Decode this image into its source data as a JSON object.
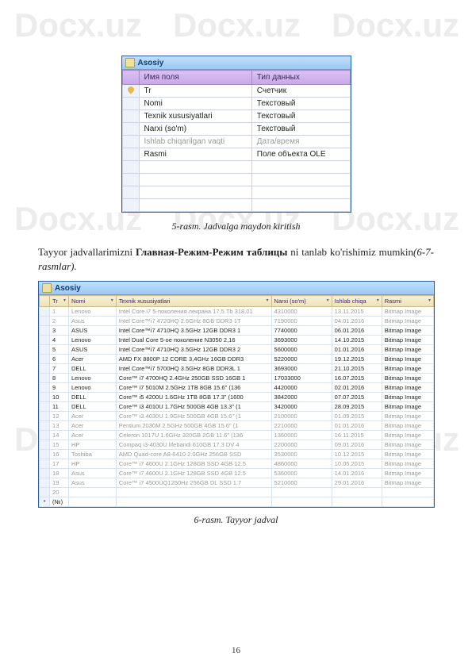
{
  "watermark": "Docx.uz",
  "page_number": "16",
  "caption1": "5-rasm. Jadvalga maydon kiritish",
  "body_text_1a": "Tayyor jadvallarimizni ",
  "body_text_1b": "Главная-Режим-Режим таблицы",
  "body_text_1c": " ni tanlab ko'rishimiz mumkin",
  "body_text_1d": "(6-7-rasmlar).",
  "caption2": "6-rasm. Tayyor jadval",
  "table1": {
    "title": "Asosiy",
    "headers": [
      "",
      "Имя поля",
      "Тип данных"
    ],
    "rows": [
      {
        "key": true,
        "name": "Tr",
        "type": "Счетчик"
      },
      {
        "key": false,
        "name": "Nomi",
        "type": "Текстовый"
      },
      {
        "key": false,
        "name": "Texnik xususiyatlari",
        "type": "Текстовый"
      },
      {
        "key": false,
        "name": "Narxi (so'm)",
        "type": "Текстовый"
      },
      {
        "key": false,
        "name": "Ishlab chiqarilgan vaqti",
        "type": "Дата/время",
        "faded": true
      },
      {
        "key": false,
        "name": "Rasmi",
        "type": "Поле объекта OLE"
      }
    ]
  },
  "table2": {
    "title": "Asosiy",
    "headers": [
      "",
      "Tr",
      "Nomi",
      "Texnik xususiyatlari",
      "Narxi (so'm)",
      "Ishlab chiqa",
      "Rasmi"
    ],
    "rows": [
      {
        "tr": "1",
        "nomi": "Lenovo",
        "tx": "Intel Core i7 5-поколения лекрана 17,5 Tb 318.01",
        "narx": "4310000",
        "ish": "13.11.2015",
        "rasmi": "Bitmap Image",
        "faded": true
      },
      {
        "tr": "2",
        "nomi": "Asus",
        "tx": "Intel Core™i7 4720HQ 2.6GHz 8GB DDR3 1T",
        "narx": "7190000",
        "ish": "04.01.2016",
        "rasmi": "Bitmap Image",
        "faded": true
      },
      {
        "tr": "3",
        "nomi": "ASUS",
        "tx": "Intel Core™i7 4710HQ 3.5GHz 12GB DDR3 1",
        "narx": "7740000",
        "ish": "06.01.2016",
        "rasmi": "Bitmap Image"
      },
      {
        "tr": "4",
        "nomi": "Lenovo",
        "tx": "Intel Dual Core 5-ое поколение N3050 2,16",
        "narx": "3693000",
        "ish": "14.10.2015",
        "rasmi": "Bitmap Image"
      },
      {
        "tr": "5",
        "nomi": "ASUS",
        "tx": "Intel Core™i7 4710HQ 3.5GHz 12GB DDR3 2",
        "narx": "5600000",
        "ish": "01.01.2016",
        "rasmi": "Bitmap Image"
      },
      {
        "tr": "6",
        "nomi": "Acer",
        "tx": "AMD FX 8800P 12 CORE 3,4GHz 16GB DDR3",
        "narx": "5220000",
        "ish": "19.12.2015",
        "rasmi": "Bitmap Image"
      },
      {
        "tr": "7",
        "nomi": "DELL",
        "tx": "Intel Core™i7 5700HQ 3.5GHz 8GB DDR3L 1",
        "narx": "3693000",
        "ish": "21.10.2015",
        "rasmi": "Bitmap Image"
      },
      {
        "tr": "8",
        "nomi": "Lenovo",
        "tx": "Core™ i7 4700HQ 2.4GHz 250GB SSD 16GB 1",
        "narx": "17033000",
        "ish": "16.07.2015",
        "rasmi": "Bitmap Image"
      },
      {
        "tr": "9",
        "nomi": "Lenovo",
        "tx": "Core™ i7 5010M 2.5GHz 1TB 8GB 15.6\" (136",
        "narx": "4420000",
        "ish": "02.01.2016",
        "rasmi": "Bitmap Image"
      },
      {
        "tr": "10",
        "nomi": "DELL",
        "tx": "Core™ i5 4200U 1.6GHz 1TB 8GB 17.3\" (1600",
        "narx": "3842000",
        "ish": "07.07.2015",
        "rasmi": "Bitmap Image"
      },
      {
        "tr": "11",
        "nomi": "DELL",
        "tx": "Core™ i3 4010U 1.7GHz 500GB 4GB 13.3\" (1",
        "narx": "3420000",
        "ish": "28.09.2015",
        "rasmi": "Bitmap Image"
      },
      {
        "tr": "12",
        "nomi": "Acer",
        "tx": "Core™ i3 4030U 1.9GHz 500GB 4GB 15.6\" (1",
        "narx": "2100000",
        "ish": "01.09.2015",
        "rasmi": "Bitmap Image",
        "faded": true
      },
      {
        "tr": "13",
        "nomi": "Acer",
        "tx": "Pentium 2030M 2.5GHz 500GB 4GB 15.6\" (1",
        "narx": "2210000",
        "ish": "01.01.2016",
        "rasmi": "Bitmap Image",
        "faded": true
      },
      {
        "tr": "14",
        "nomi": "Acer",
        "tx": "Celeron 1017U 1.6GHz 320GB 2GB 11.6\" (136",
        "narx": "1360000",
        "ish": "16.11.2015",
        "rasmi": "Bitmap Image",
        "faded": true
      },
      {
        "tr": "15",
        "nomi": "HP",
        "tx": "Compaq i3-4030U lifebandi 610GB 17.3 DV 4",
        "narx": "2200000",
        "ish": "09.01.2016",
        "rasmi": "Bitmap Image",
        "faded": true
      },
      {
        "tr": "16",
        "nomi": "Toshiba",
        "tx": "AMD Quad-core A8-6410 2.0GHz 256GB SSD",
        "narx": "3530000",
        "ish": "10.12.2015",
        "rasmi": "Bitmap Image",
        "faded": true
      },
      {
        "tr": "17",
        "nomi": "HP",
        "tx": "Core™ i7 4600U 2.1GHz 128GB SSD 4GB 12.5",
        "narx": "4860000",
        "ish": "10.05.2015",
        "rasmi": "Bitmap Image",
        "faded": true
      },
      {
        "tr": "18",
        "nomi": "Asus",
        "tx": "Core™ i7 4600U 2.1GHz 128GB SSD 4GB 12.5",
        "narx": "5360000",
        "ish": "14.01.2016",
        "rasmi": "Bitmap Image",
        "faded": true
      },
      {
        "tr": "19",
        "nomi": "Asus",
        "tx": "Core™ i7 4500UQ1250Hz 256GB DL SSD 1.7",
        "narx": "5210000",
        "ish": "29.01.2016",
        "rasmi": "Bitmap Image",
        "faded": true
      }
    ],
    "new_row_label": "(№)",
    "new_row_tr": "20"
  }
}
